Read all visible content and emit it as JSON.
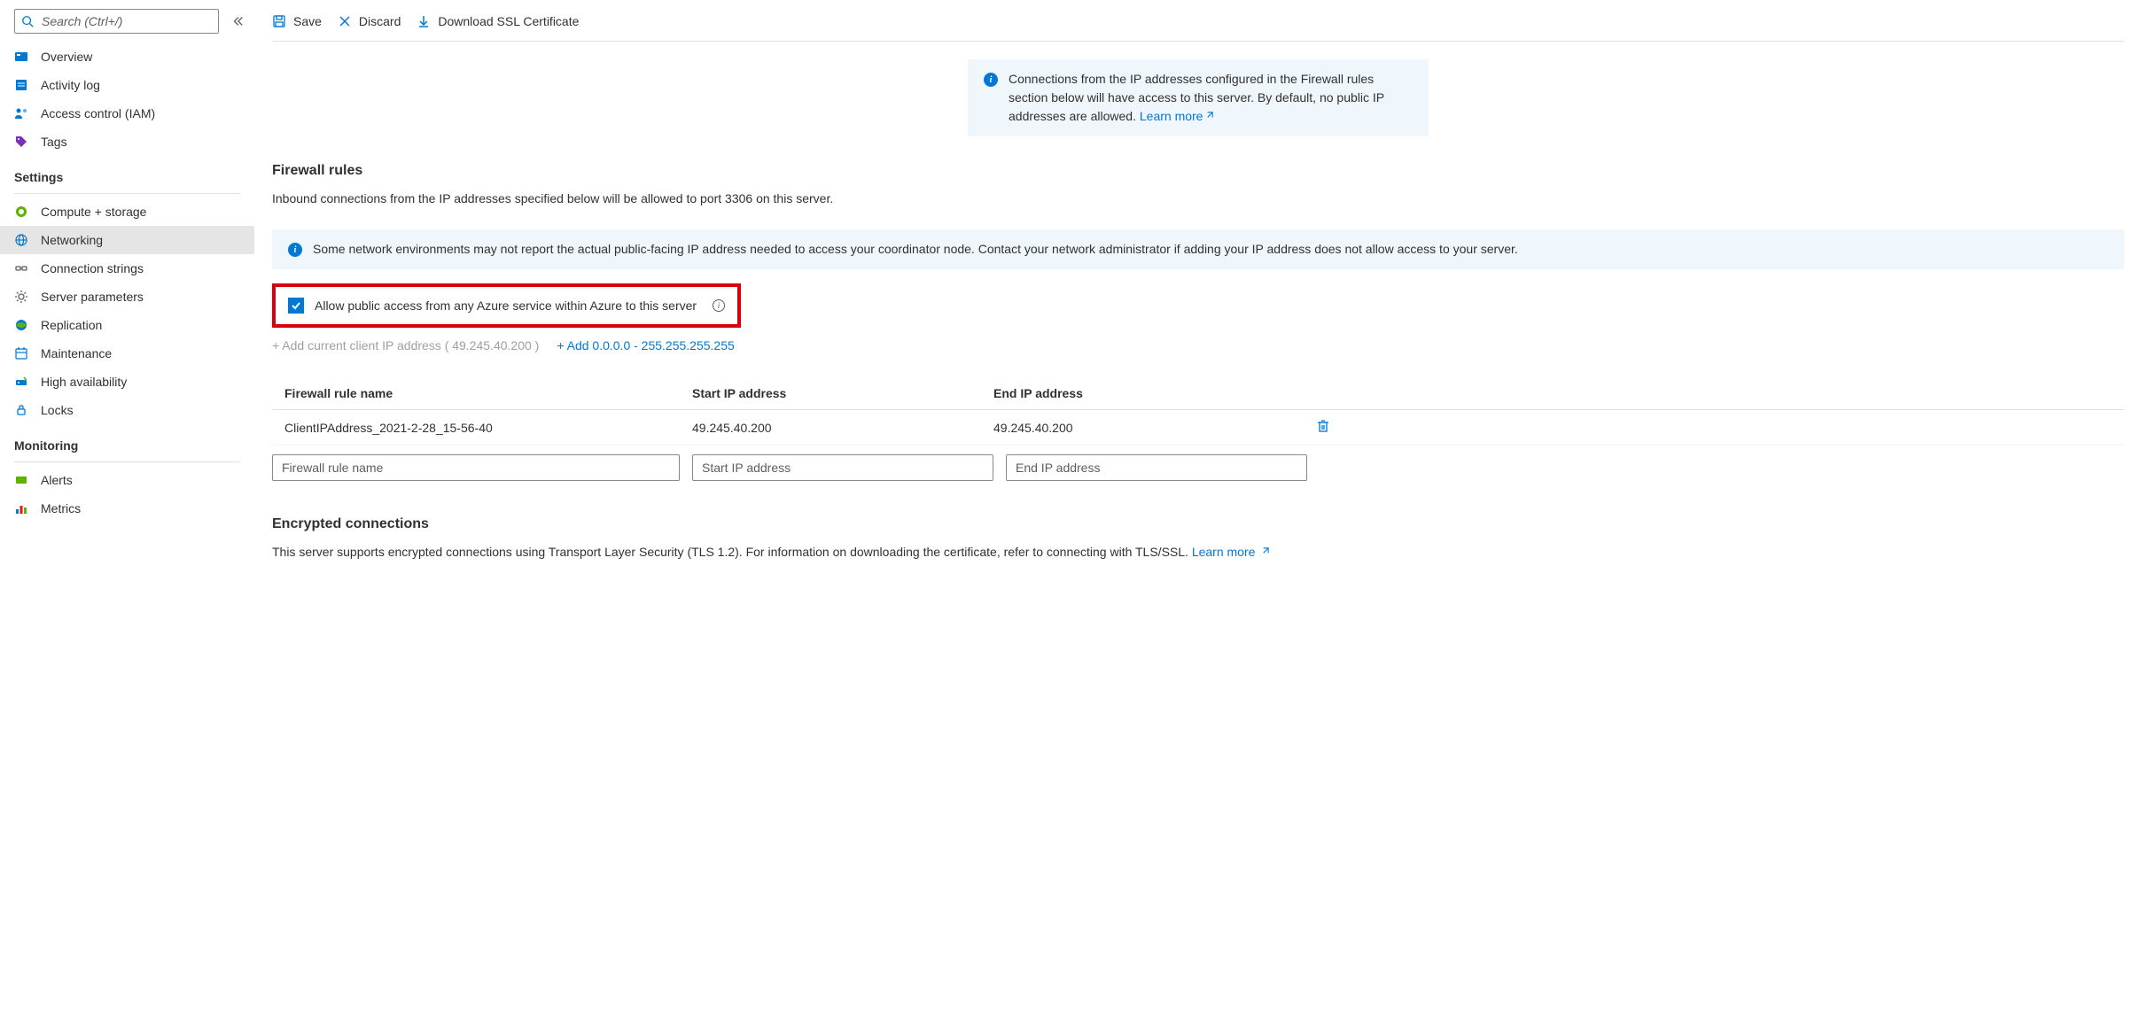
{
  "search": {
    "placeholder": "Search (Ctrl+/)"
  },
  "sidebar": {
    "top": [
      {
        "label": "Overview",
        "icon": "overview"
      },
      {
        "label": "Activity log",
        "icon": "activity-log"
      },
      {
        "label": "Access control (IAM)",
        "icon": "access-control"
      },
      {
        "label": "Tags",
        "icon": "tags"
      }
    ],
    "settings_label": "Settings",
    "settings": [
      {
        "label": "Compute + storage",
        "icon": "compute"
      },
      {
        "label": "Networking",
        "icon": "networking",
        "active": true
      },
      {
        "label": "Connection strings",
        "icon": "connection-strings"
      },
      {
        "label": "Server parameters",
        "icon": "server-params"
      },
      {
        "label": "Replication",
        "icon": "replication"
      },
      {
        "label": "Maintenance",
        "icon": "maintenance"
      },
      {
        "label": "High availability",
        "icon": "high-availability"
      },
      {
        "label": "Locks",
        "icon": "locks"
      }
    ],
    "monitoring_label": "Monitoring",
    "monitoring": [
      {
        "label": "Alerts",
        "icon": "alerts"
      },
      {
        "label": "Metrics",
        "icon": "metrics"
      }
    ]
  },
  "toolbar": {
    "save": "Save",
    "discard": "Discard",
    "download_ssl": "Download SSL Certificate"
  },
  "connections_banner": {
    "text": "Connections from the IP addresses configured in the Firewall rules section below will have access to this server. By default, no public IP addresses are allowed.",
    "link_label": "Learn more"
  },
  "firewall": {
    "title": "Firewall rules",
    "description": "Inbound connections from the IP addresses specified below will be allowed to port 3306 on this server.",
    "network_banner": "Some network environments may not report the actual public-facing IP address needed to access your coordinator node. Contact your network administrator if adding your IP address does not allow access to your server.",
    "allow_azure_label": "Allow public access from any Azure service within Azure to this server",
    "add_client_ip": "+ Add current client IP address ( 49.245.40.200 )",
    "add_range": "+ Add 0.0.0.0 - 255.255.255.255",
    "headers": {
      "name": "Firewall rule name",
      "start": "Start IP address",
      "end": "End IP address"
    },
    "rows": [
      {
        "name": "ClientIPAddress_2021-2-28_15-56-40",
        "start": "49.245.40.200",
        "end": "49.245.40.200"
      }
    ],
    "placeholders": {
      "name": "Firewall rule name",
      "start": "Start IP address",
      "end": "End IP address"
    }
  },
  "encrypted": {
    "title": "Encrypted connections",
    "description": "This server supports encrypted connections using Transport Layer Security (TLS 1.2). For information on downloading the certificate, refer to connecting with TLS/SSL.",
    "link_label": "Learn more"
  }
}
